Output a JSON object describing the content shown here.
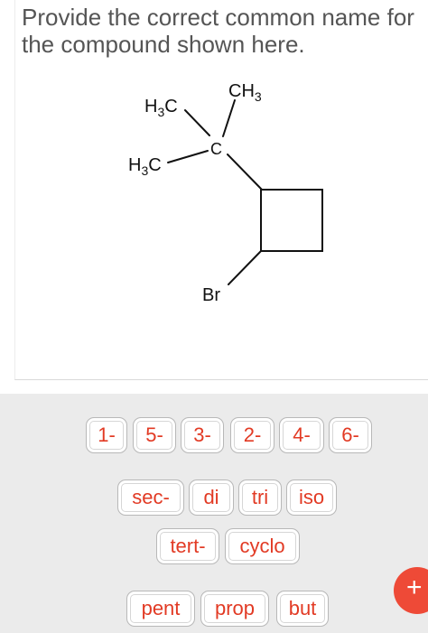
{
  "question": {
    "prompt": "Provide the correct common name for the compound shown here."
  },
  "structure": {
    "atoms": {
      "top_methyl": "CH",
      "top_methyl_sub": "3",
      "upper_left_methyl": "H",
      "upper_left_methyl_sub": "3",
      "upper_left_methyl_tail": "C",
      "lower_left_methyl": "H",
      "lower_left_methyl_sub": "3",
      "lower_left_methyl_tail": "C",
      "central_carbon": "C",
      "bromine": "Br"
    }
  },
  "word_bank": {
    "row1": [
      "1-",
      "5-",
      "3-",
      "2-",
      "4-",
      "6-"
    ],
    "row2": [
      "sec-",
      "di",
      "tri",
      "iso"
    ],
    "row3": [
      "tert-",
      "cyclo"
    ],
    "row4": [
      "pent",
      "prop",
      "but"
    ]
  },
  "add_button": {
    "label": "+",
    "icon": "plus-icon"
  },
  "colors": {
    "chip_text": "#e23a24",
    "add_button": "#ee4a37",
    "bank_background": "#ebebeb",
    "prompt_text": "#555555"
  }
}
